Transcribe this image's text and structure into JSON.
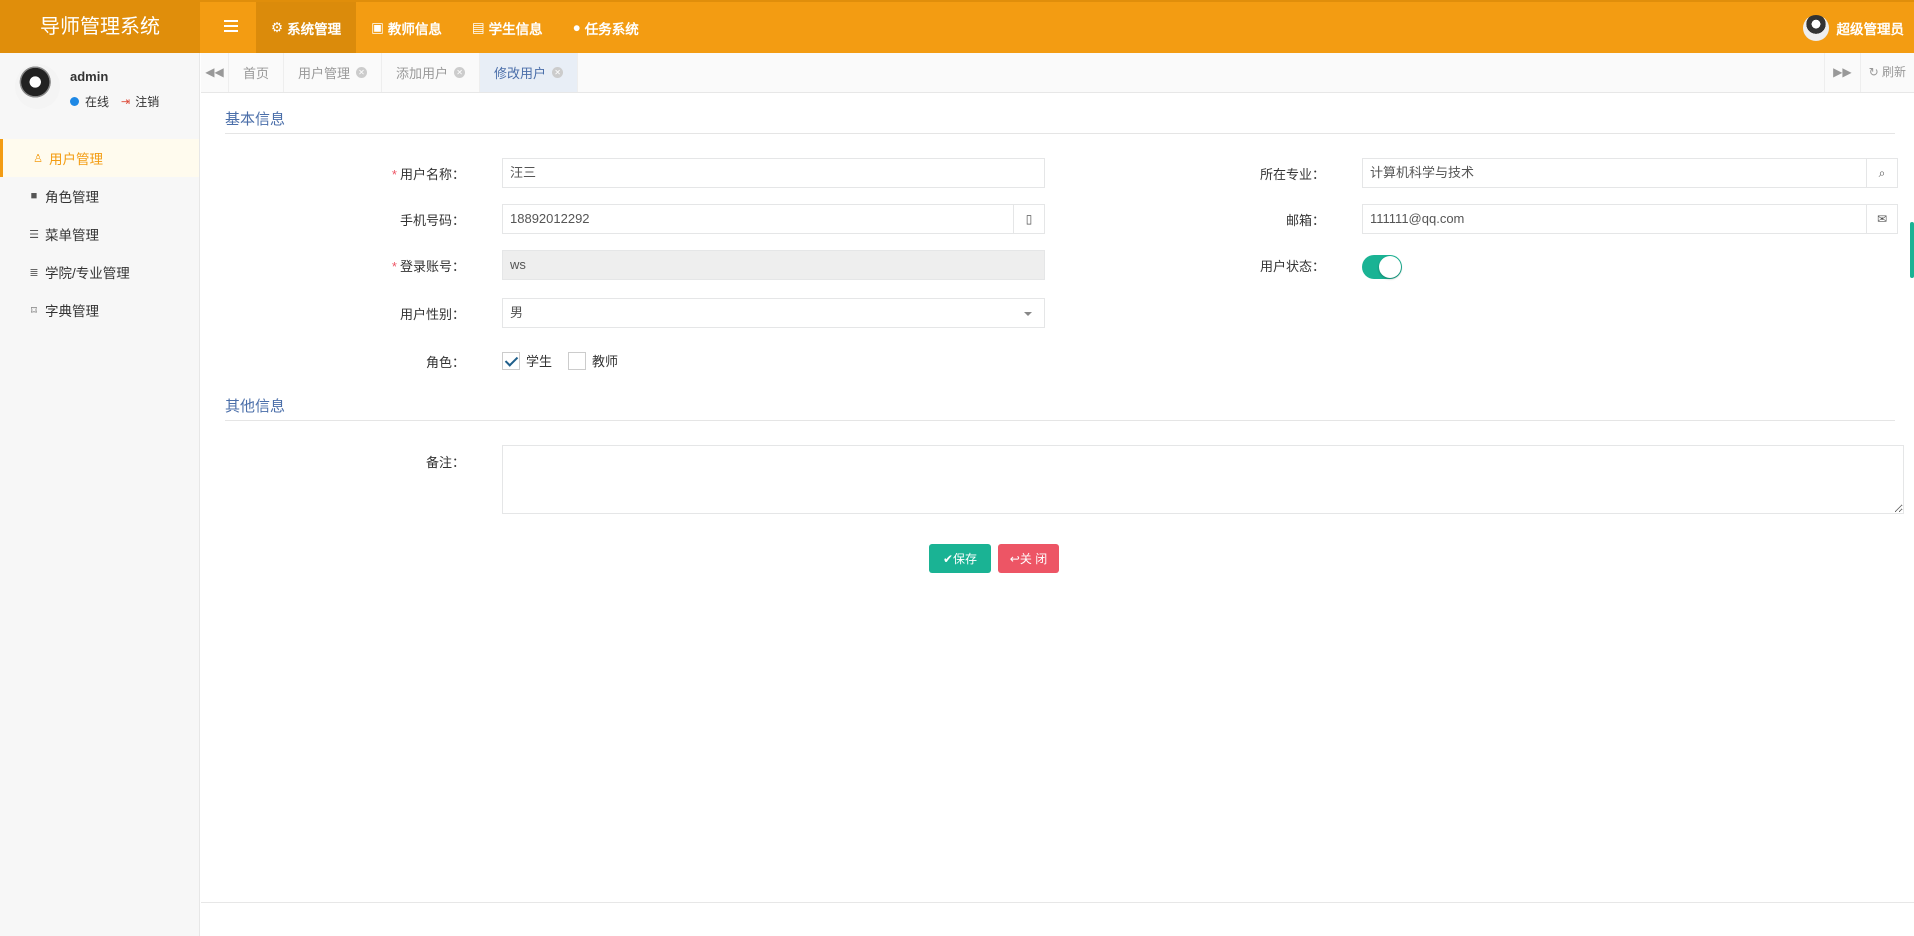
{
  "app": {
    "title": "导师管理系统"
  },
  "topnav": {
    "items": [
      {
        "label": "系统管理",
        "active": true
      },
      {
        "label": "教师信息"
      },
      {
        "label": "学生信息"
      },
      {
        "label": "任务系统"
      }
    ],
    "user": "超级管理员"
  },
  "sidebar": {
    "user": {
      "name": "admin",
      "online": "在线",
      "logout": "注销"
    },
    "items": [
      {
        "label": "用户管理",
        "active": true
      },
      {
        "label": "角色管理"
      },
      {
        "label": "菜单管理"
      },
      {
        "label": "学院/专业管理"
      },
      {
        "label": "字典管理"
      }
    ]
  },
  "tabs": {
    "items": [
      {
        "label": "首页"
      },
      {
        "label": "用户管理"
      },
      {
        "label": "添加用户"
      },
      {
        "label": "修改用户",
        "active": true
      }
    ],
    "refresh": "刷新"
  },
  "form": {
    "basic_title": "基本信息",
    "other_title": "其他信息",
    "username_label": "用户名称：",
    "username_value": "汪三",
    "major_label": "所在专业：",
    "major_value": "计算机科学与技术",
    "phone_label": "手机号码：",
    "phone_value": "18892012292",
    "email_label": "邮箱：",
    "email_value": "111111@qq.com",
    "account_label": "登录账号：",
    "account_value": "ws",
    "status_label": "用户状态：",
    "status_on": true,
    "gender_label": "用户性别：",
    "gender_value": "男",
    "role_label": "角色：",
    "roles": [
      {
        "label": "学生",
        "checked": true
      },
      {
        "label": "教师",
        "checked": false
      }
    ],
    "remark_label": "备注：",
    "remark_value": ""
  },
  "buttons": {
    "save": "保存",
    "close": "关 闭"
  },
  "colors": {
    "header": "#f39c12",
    "logo_bg": "#e08e0b",
    "primary": "#1ab394",
    "danger": "#ed5565",
    "section": "#4a6ea9"
  }
}
